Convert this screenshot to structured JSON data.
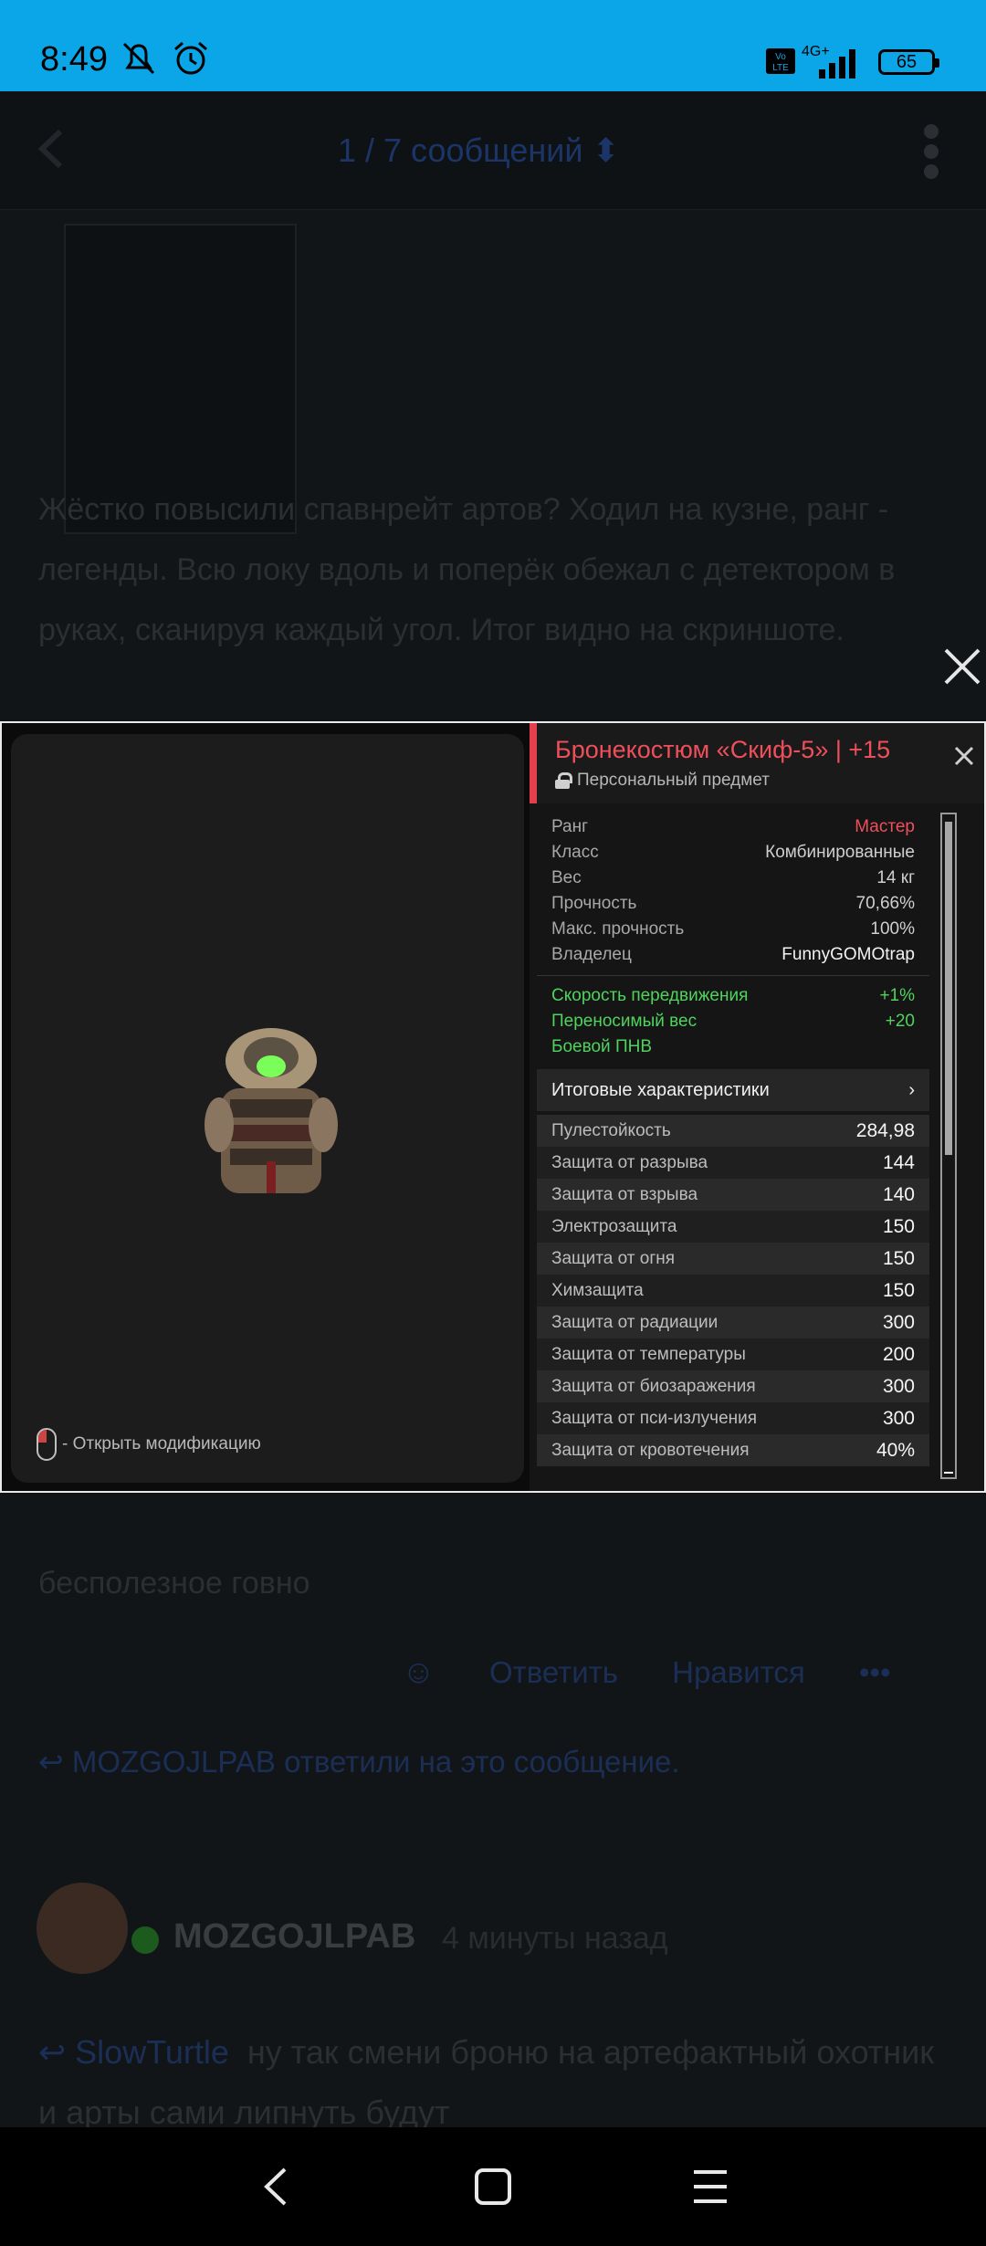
{
  "status_bar": {
    "time": "8:49",
    "battery": "65",
    "network": "4G+"
  },
  "topbar": {
    "counter": "1 / 7 сообщений ⬍"
  },
  "post": {
    "text": "Жёстко повысили спавнрейт артов? Ходил на кузне, ранг - легенды. Всю локу вдоль и поперёк обежал с детектором в руках, сканируя каждый угол. Итог видно на скриншоте.",
    "text2": "бесполезное говно"
  },
  "actions": {
    "reply": "Ответить",
    "like": "Нравится",
    "more": "•••"
  },
  "replied_notice": "MOZGOJLPAB ответили на это сообщение.",
  "reply": {
    "author": "MOZGOJLPAB",
    "time": "4 минуты назад",
    "mention": "SlowTurtle",
    "text": "ну так смени броню на артефактный охотник и арты сами липнуть будут"
  },
  "game": {
    "item_title": "Бронекостюм «Скиф-5» | +15",
    "item_subtitle": "Персональный предмет",
    "hint": "- Открыть модификацию",
    "stats": [
      {
        "label": "Ранг",
        "value": "Мастер",
        "style": "red"
      },
      {
        "label": "Класс",
        "value": "Комбинированные",
        "style": ""
      },
      {
        "label": "Вес",
        "value": "14 кг",
        "style": ""
      },
      {
        "label": "Прочность",
        "value": "70,66%",
        "style": ""
      },
      {
        "label": "Макс. прочность",
        "value": "100%",
        "style": ""
      },
      {
        "label": "Владелец",
        "value": "FunnyGOMOtrap",
        "style": "white"
      }
    ],
    "bonuses": [
      {
        "label": "Скорость передвижения",
        "value": "+1%"
      },
      {
        "label": "Переносимый вес",
        "value": "+20"
      },
      {
        "label": "Боевой ПНВ",
        "value": ""
      }
    ],
    "summary_label": "Итоговые характеристики",
    "resists": [
      {
        "label": "Пулестойкость",
        "value": "284,98"
      },
      {
        "label": "Защита от разрыва",
        "value": "144"
      },
      {
        "label": "Защита от взрыва",
        "value": "140"
      },
      {
        "label": "Электрозащита",
        "value": "150"
      },
      {
        "label": "Защита от огня",
        "value": "150"
      },
      {
        "label": "Химзащита",
        "value": "150"
      },
      {
        "label": "Защита от радиации",
        "value": "300"
      },
      {
        "label": "Защита от температуры",
        "value": "200"
      },
      {
        "label": "Защита от биозаражения",
        "value": "300"
      },
      {
        "label": "Защита от пси-излучения",
        "value": "300"
      },
      {
        "label": "Защита от кровотечения",
        "value": "40%"
      }
    ]
  },
  "colors": {
    "status_bar": "#0aa6e8",
    "accent_red": "#ee4f5b",
    "bonus_green": "#4fd35e"
  }
}
